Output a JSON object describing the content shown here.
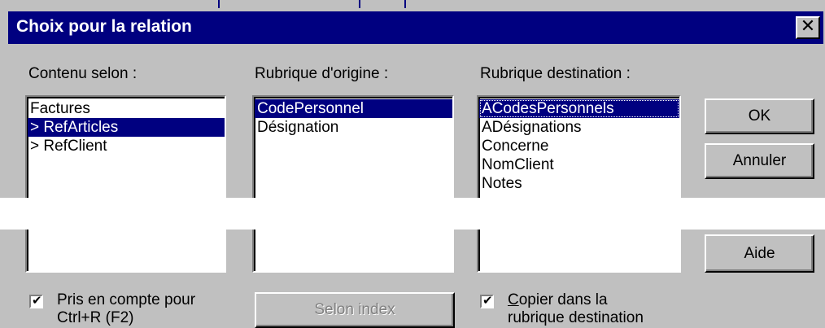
{
  "dialog": {
    "title": "Choix pour la relation",
    "close_glyph": "✕"
  },
  "columns": {
    "contenu": {
      "label": "Contenu selon :",
      "items": [
        "Factures",
        "> RefArticles",
        "> RefClient"
      ],
      "selected_index": 1
    },
    "origine": {
      "label": "Rubrique d'origine :",
      "items": [
        "CodePersonnel",
        "Désignation"
      ],
      "selected_index": 0
    },
    "destination": {
      "label": "Rubrique destination :",
      "items": [
        "ACodesPersonnels",
        "ADésignations",
        "Concerne",
        "NomClient",
        "Notes"
      ],
      "selected_index": 0
    }
  },
  "buttons": {
    "ok": "OK",
    "annuler": "Annuler",
    "aide": "Aide",
    "selon_index": "Selon index"
  },
  "checkboxes": {
    "pris_en_compte": {
      "line1": "Pris en compte pour",
      "line2": "Ctrl+R (F2)",
      "checked": true
    },
    "copier": {
      "mnemonic": "C",
      "line1_rest": "opier dans la",
      "line2": "rubrique destination",
      "checked": true
    }
  }
}
